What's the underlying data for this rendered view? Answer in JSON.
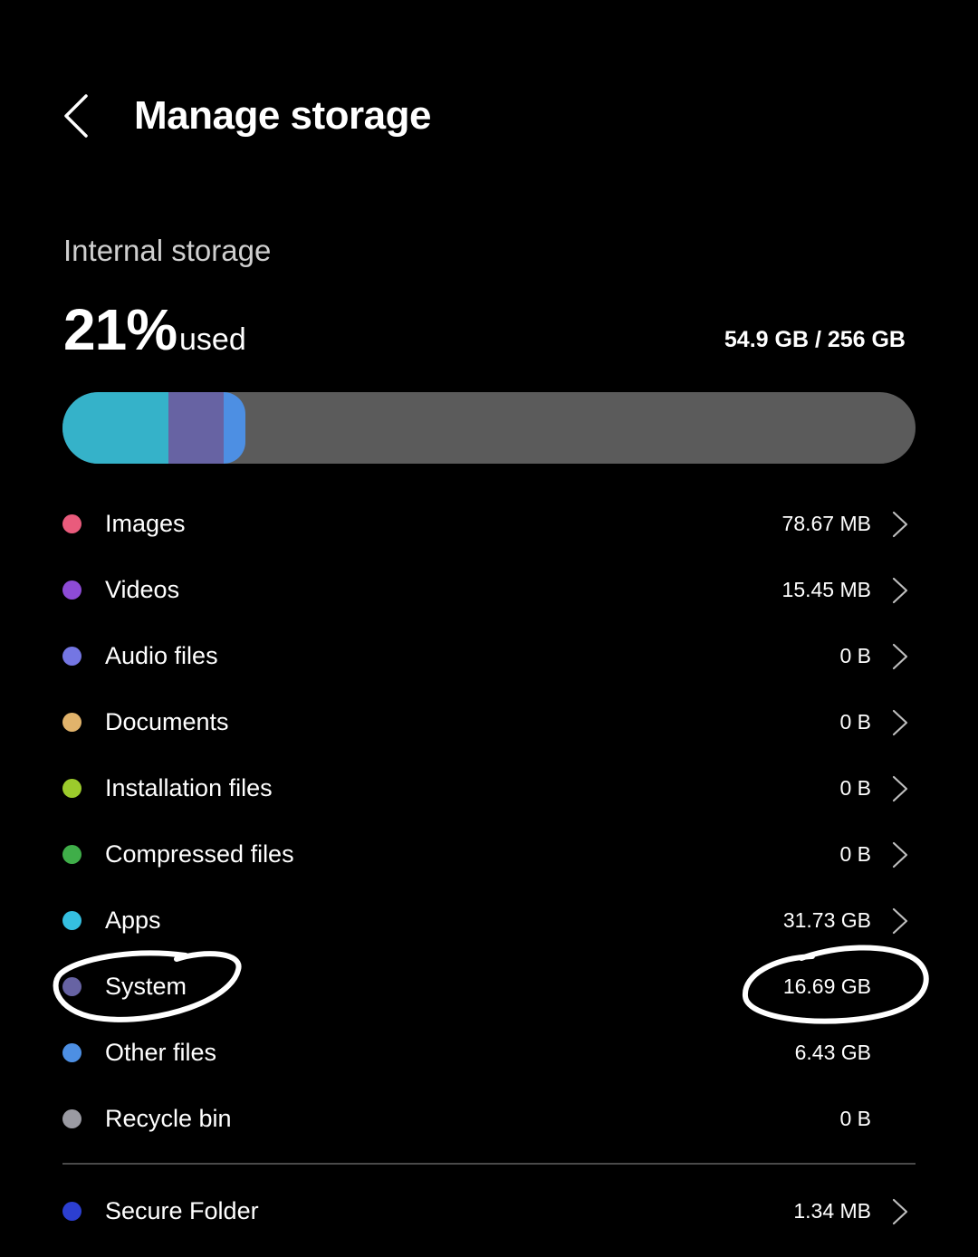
{
  "header": {
    "title": "Manage storage",
    "back_icon": "chevron-left-icon"
  },
  "storage": {
    "section_label": "Internal storage",
    "percent_used": "21%",
    "used_word": "used",
    "used_total": "54.9 GB / 256 GB",
    "bar_segments": [
      {
        "name": "Apps",
        "color": "#35b2c9",
        "fraction": 0.124
      },
      {
        "name": "System",
        "color": "#6763a3",
        "fraction": 0.065
      },
      {
        "name": "Other files",
        "color": "#4d8fe3",
        "fraction": 0.025
      }
    ]
  },
  "categories": [
    {
      "label": "Images",
      "size": "78.67 MB",
      "color": "#e95b7c",
      "has_chevron": true
    },
    {
      "label": "Videos",
      "size": "15.45 MB",
      "color": "#8d4bd6",
      "has_chevron": true
    },
    {
      "label": "Audio files",
      "size": "0 B",
      "color": "#7476e3",
      "has_chevron": true
    },
    {
      "label": "Documents",
      "size": "0 B",
      "color": "#e1b36b",
      "has_chevron": true
    },
    {
      "label": "Installation files",
      "size": "0 B",
      "color": "#9ccb2c",
      "has_chevron": true
    },
    {
      "label": "Compressed files",
      "size": "0 B",
      "color": "#3fae49",
      "has_chevron": true
    },
    {
      "label": "Apps",
      "size": "31.73 GB",
      "color": "#35bfe0",
      "has_chevron": true
    },
    {
      "label": "System",
      "size": "16.69 GB",
      "color": "#6763a3",
      "has_chevron": false
    },
    {
      "label": "Other files",
      "size": "6.43 GB",
      "color": "#4d8fe3",
      "has_chevron": false
    },
    {
      "label": "Recycle bin",
      "size": "0 B",
      "color": "#9a9aa2",
      "has_chevron": false
    }
  ],
  "secure_folder": {
    "label": "Secure Folder",
    "size": "1.34 MB",
    "color": "#2c3fd1",
    "has_chevron": true
  },
  "colors": {
    "background": "#000000",
    "text": "#ffffff",
    "bar_track": "#5b5b5b",
    "annotation": "#ffffff"
  }
}
